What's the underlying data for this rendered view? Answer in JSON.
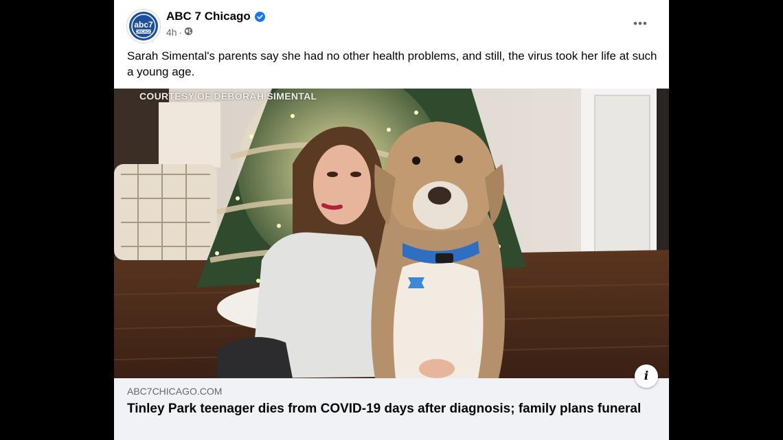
{
  "post": {
    "page_name": "ABC 7 Chicago",
    "timestamp": "4h",
    "separator": "·",
    "privacy_icon": "globe-icon",
    "verified_icon": "verified-badge-icon",
    "more_icon": "more-options-icon",
    "caption": "Sarah Simental's parents say she had no other health problems, and still, the virus took her life at such a young age."
  },
  "avatar": {
    "logo_text": "abc7",
    "logo_subtext": "CHICAGO"
  },
  "media": {
    "credit": "COURTESY OF DEBORAH SIMENTAL",
    "info_icon": "info-icon",
    "info_glyph": "i"
  },
  "link_card": {
    "domain": "ABC7CHICAGO.COM",
    "headline": "Tinley Park teenager dies from COVID-19 days after diagnosis; family plans funeral"
  },
  "colors": {
    "brand_blue": "#1877f2",
    "abc_blue": "#1c4f9c",
    "text_primary": "#050505",
    "text_secondary": "#65676b",
    "card_bg": "#f0f2f5"
  }
}
